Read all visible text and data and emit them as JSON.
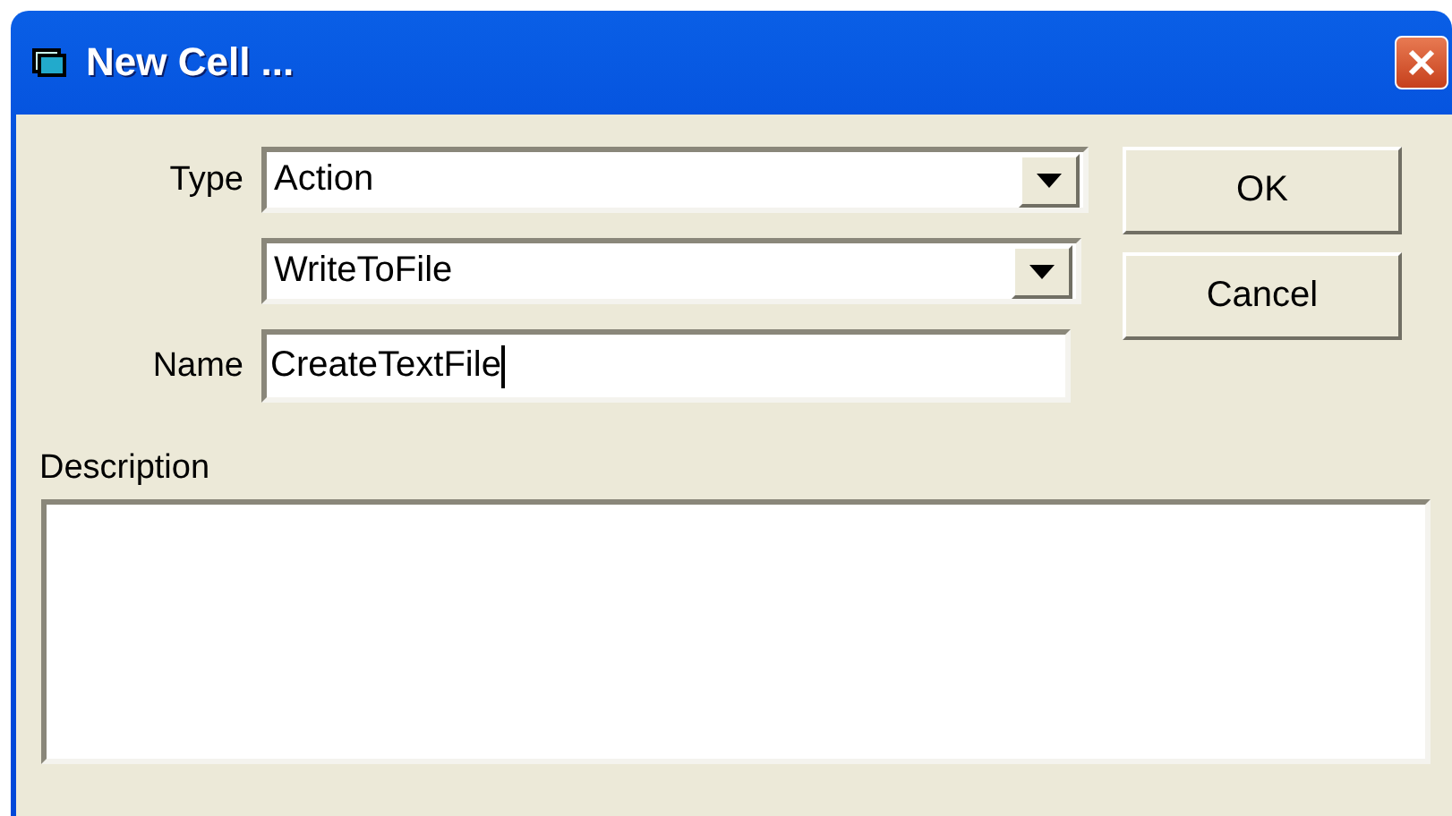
{
  "window": {
    "title": "New Cell ..."
  },
  "type_field": {
    "label": "Type",
    "value": "Action"
  },
  "subtype_field": {
    "value": "WriteToFile"
  },
  "name_field": {
    "label": "Name",
    "value": "CreateTextFile"
  },
  "description": {
    "label": "Description"
  },
  "buttons": [
    "OK",
    "Cancel"
  ]
}
